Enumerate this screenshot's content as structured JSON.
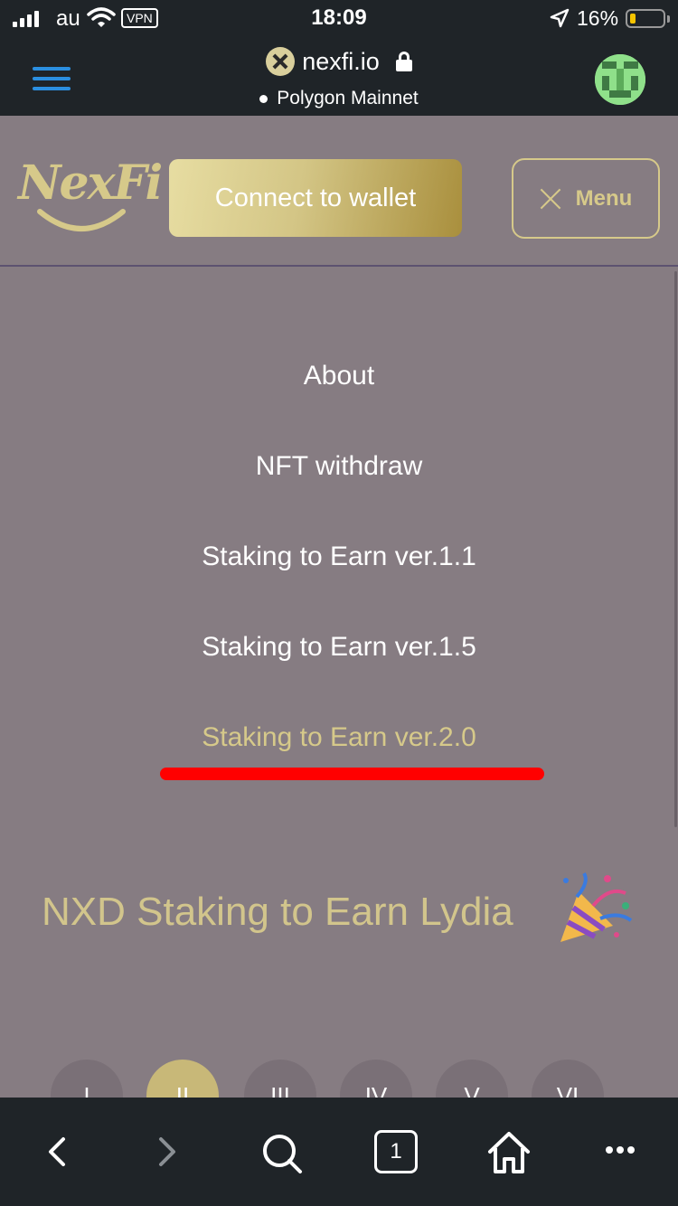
{
  "status_bar": {
    "carrier": "au",
    "vpn": "VPN",
    "time": "18:09",
    "battery": "16%"
  },
  "browser": {
    "domain": "nexfi.io",
    "network": "Polygon Mainnet",
    "tab_count": "1",
    "icons": [
      "back-icon",
      "forward-icon",
      "search-icon",
      "tabs-icon",
      "home-icon",
      "more-icon"
    ]
  },
  "site": {
    "logo": "NexFi",
    "connect_label": "Connect to wallet",
    "menu_label": "Menu"
  },
  "menu": {
    "items": [
      {
        "label": "About"
      },
      {
        "label": "NFT withdraw"
      },
      {
        "label": "Staking to Earn ver.1.1"
      },
      {
        "label": "Staking to Earn ver.1.5"
      },
      {
        "label": "Staking to Earn ver.2.0"
      }
    ]
  },
  "heading": "NXD Staking to Earn Lydia",
  "steps": [
    "I",
    "II",
    "III",
    "IV",
    "V",
    "VI"
  ],
  "colors": {
    "gold": "#d6c98a",
    "background": "#867c82",
    "chrome": "#1f2428",
    "highlight": "#ff0000"
  }
}
